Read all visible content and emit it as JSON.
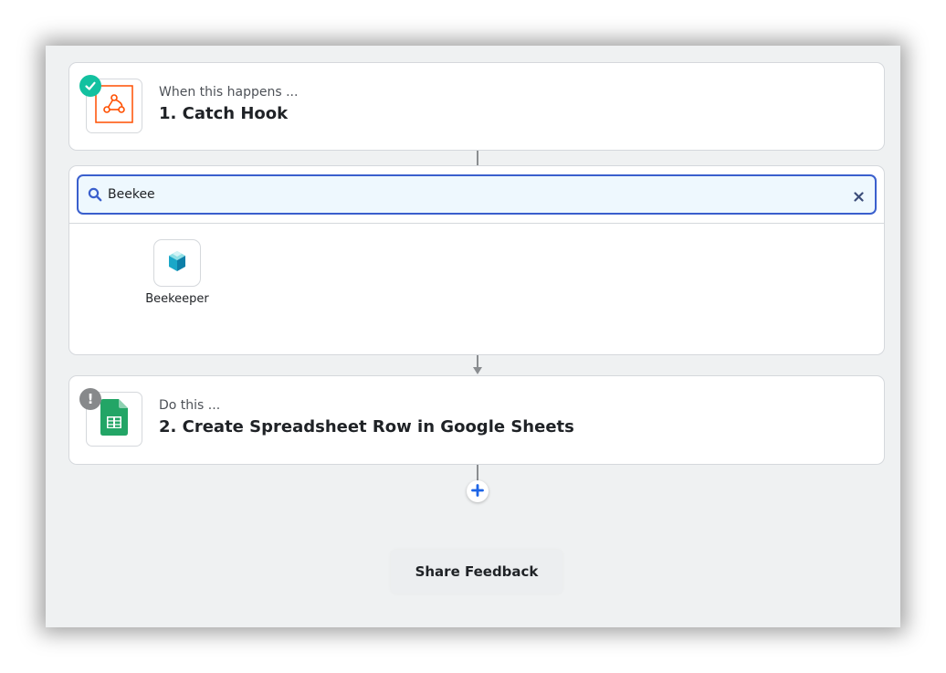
{
  "steps": [
    {
      "subtitle": "When this happens ...",
      "title": "1. Catch Hook",
      "icon": "webhook-icon",
      "status": "complete"
    },
    {
      "subtitle": "Do this ...",
      "title": "2. Create Spreadsheet Row in Google Sheets",
      "icon": "google-sheets-icon",
      "status": "warning",
      "status_symbol": "!"
    }
  ],
  "search": {
    "value": "Beekee",
    "icon": "search-icon",
    "clear_icon": "close-icon"
  },
  "results": [
    {
      "label": "Beekeeper",
      "icon": "beekeeper-icon"
    }
  ],
  "add_step_icon": "plus-icon",
  "feedback": {
    "label": "Share Feedback"
  },
  "colors": {
    "accent": "#3a5fcd",
    "success": "#13c1a0",
    "warning": "#87898b",
    "webhook": "#ff4f00",
    "sheets": "#23a566",
    "plus": "#1d64e6"
  }
}
